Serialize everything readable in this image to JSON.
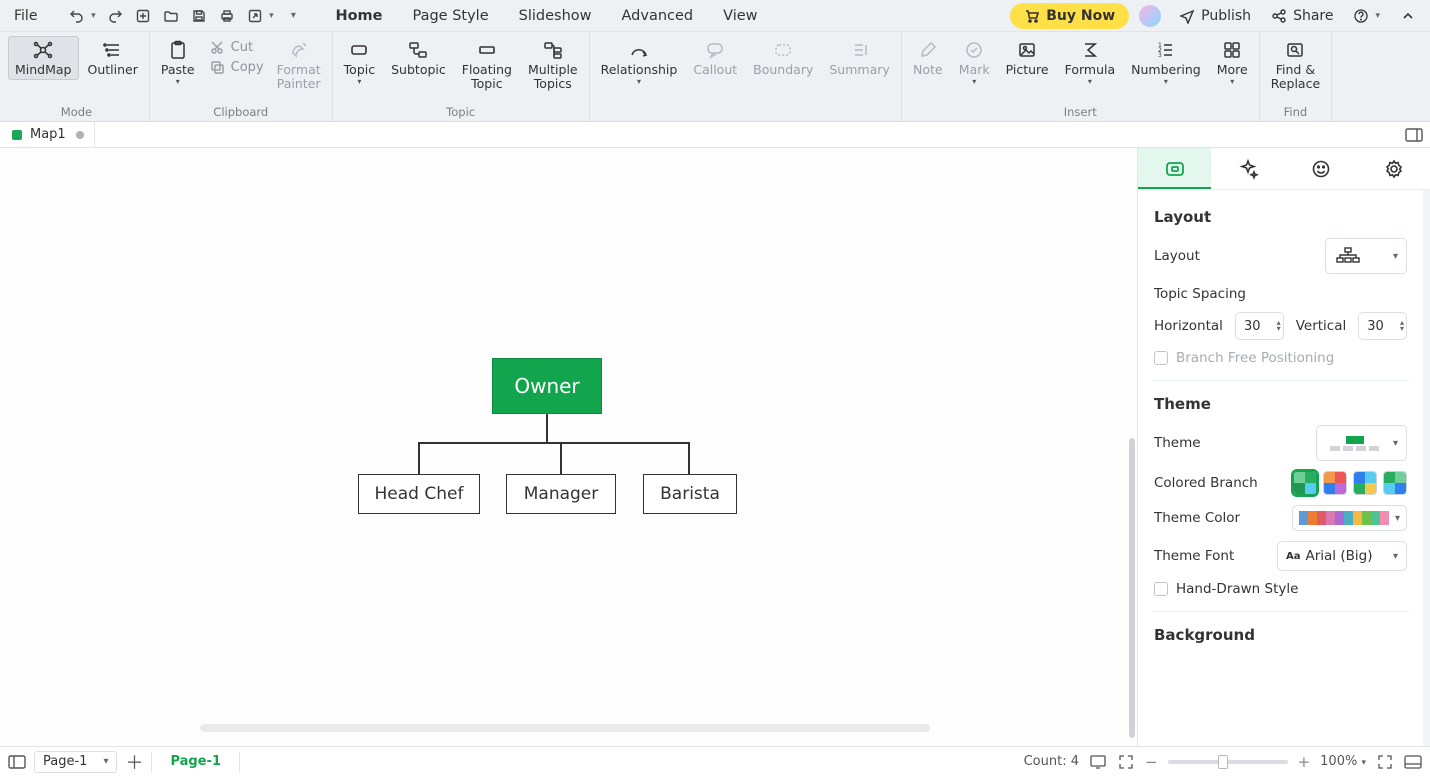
{
  "menu": {
    "file": "File",
    "tabs": [
      "Home",
      "Page Style",
      "Slideshow",
      "Advanced",
      "View"
    ],
    "active_tab": "Home",
    "buy_now": "Buy Now",
    "publish": "Publish",
    "share": "Share"
  },
  "ribbon": {
    "mode": {
      "mindmap": "MindMap",
      "outliner": "Outliner",
      "label": "Mode"
    },
    "clipboard": {
      "paste": "Paste",
      "cut": "Cut",
      "copy": "Copy",
      "format_painter": "Format\nPainter",
      "label": "Clipboard"
    },
    "topic": {
      "topic": "Topic",
      "subtopic": "Subtopic",
      "floating": "Floating\nTopic",
      "multiple": "Multiple\nTopics",
      "label": "Topic"
    },
    "rel": {
      "relationship": "Relationship",
      "callout": "Callout",
      "boundary": "Boundary",
      "summary": "Summary"
    },
    "insert": {
      "note": "Note",
      "mark": "Mark",
      "picture": "Picture",
      "formula": "Formula",
      "numbering": "Numbering",
      "more": "More",
      "label": "Insert"
    },
    "find": {
      "find_replace": "Find &\nReplace",
      "label": "Find"
    }
  },
  "doctab": {
    "name": "Map1"
  },
  "diagram": {
    "root": "Owner",
    "children": [
      "Head Chef",
      "Manager",
      "Barista"
    ],
    "root_color": "#13a54d"
  },
  "sidepanel": {
    "layout": {
      "title": "Layout",
      "layout_label": "Layout",
      "spacing_title": "Topic Spacing",
      "horizontal_label": "Horizontal",
      "horizontal_value": "30",
      "vertical_label": "Vertical",
      "vertical_value": "30",
      "branch_free": "Branch Free Positioning"
    },
    "theme": {
      "title": "Theme",
      "theme_label": "Theme",
      "colored_branch": "Colored Branch",
      "theme_color": "Theme Color",
      "theme_font": "Theme Font",
      "font_value": "Arial (Big)",
      "hand_drawn": "Hand-Drawn Style",
      "palette": [
        "#5b9bd5",
        "#ed7d31",
        "#e15b64",
        "#d979b3",
        "#a96bd1",
        "#4ab0c1",
        "#f4b942",
        "#6fbf4b",
        "#4fc493",
        "#f08db0"
      ]
    },
    "background": {
      "title": "Background"
    }
  },
  "statusbar": {
    "page_dd": "Page-1",
    "page_pill": "Page-1",
    "count": "Count: 4",
    "zoom_pct": "100%"
  }
}
